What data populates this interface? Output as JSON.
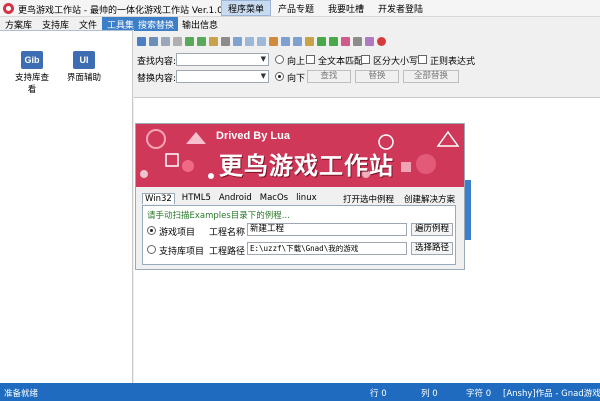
{
  "window": {
    "title": "更鸟游戏工作站 - 最帅的一体化游戏工作站 Ver.1.0"
  },
  "top_menu": [
    "程序菜单",
    "产品专题",
    "我要吐槽",
    "开发者登陆"
  ],
  "left_panel": {
    "tabs": [
      "方案库",
      "支持库",
      "文件",
      "工具集"
    ],
    "active_tab": "工具集",
    "tools": [
      {
        "icon_text": "Gib",
        "label": "支持库查看",
        "icon": "gib-icon"
      },
      {
        "icon_text": "UI",
        "label": "界面辅助",
        "icon": "ui-icon"
      }
    ]
  },
  "right_panel": {
    "tabs": [
      "搜索替换",
      "输出信息"
    ],
    "active_tab": "搜索替换",
    "find_label": "查找内容:",
    "replace_label": "替换内容:",
    "find_value": "",
    "replace_value": "",
    "dir_up": "向上",
    "dir_down": "向下",
    "opt_whole_word": "全文本匹配",
    "opt_case": "区分大小写",
    "opt_regex": "正则表达式",
    "btn_find": "查找",
    "btn_replace": "替换",
    "btn_replace_all": "全部替换"
  },
  "dialog": {
    "banner_small": "Drived By Lua",
    "banner_big": "更鸟游戏工作站",
    "platform_tabs": [
      "Win32",
      "HTML5",
      "Android",
      "MacOs",
      "linux"
    ],
    "active_platform": "Win32",
    "open_example": "打开选中例程",
    "create_solution": "创建解决方案",
    "hint": "请手动扫描Examples目录下的例程...",
    "radio_game_project": "游戏项目",
    "radio_lib_project": "支持库项目",
    "project_name_label": "工程名称",
    "project_name_value": "新建工程",
    "project_path_label": "工程路径",
    "project_path_value": "E:\\uzzf\\下载\\Gnad\\我的游戏",
    "btn_browse_example": "遍历例程",
    "btn_choose_path": "选择路径"
  },
  "status": {
    "ready": "准备就绪",
    "line_label": "行 0",
    "col_label": "列 0",
    "char_label": "字符 0",
    "credit": "[Anshy]作品 - Gnad游戏社"
  },
  "colors": {
    "accent": "#3c7ec8",
    "statusbar": "#1e6bbf",
    "banner": "#d0385a",
    "hint_green": "#2a7a2a"
  }
}
